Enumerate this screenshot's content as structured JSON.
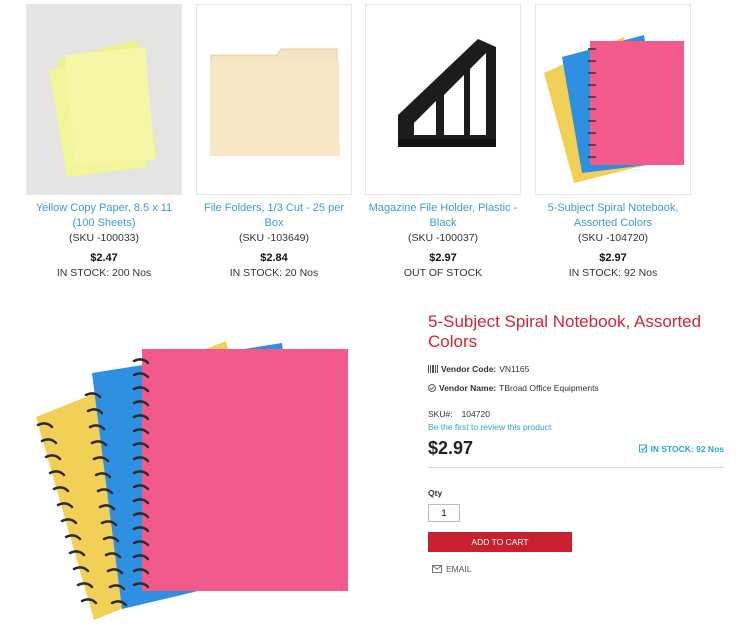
{
  "related_products": [
    {
      "name": "Yellow Copy Paper, 8.5 x 11 (100 Sheets)",
      "sku": "(SKU -100033)",
      "price": "$2.47",
      "stock": "IN STOCK: 200 Nos"
    },
    {
      "name": "File Folders, 1/3 Cut - 25 per Box",
      "sku": "(SKU -103649)",
      "price": "$2.84",
      "stock": "IN STOCK: 20 Nos"
    },
    {
      "name": "Magazine File Holder, Plastic - Black",
      "sku": "(SKU -100037)",
      "price": "$2.97",
      "stock": "OUT OF STOCK"
    },
    {
      "name": "5-Subject Spiral Notebook, Assorted Colors",
      "sku": "(SKU -104720)",
      "price": "$2.97",
      "stock": "IN STOCK: 92 Nos"
    }
  ],
  "product": {
    "title": "5-Subject Spiral Notebook, Assorted Colors",
    "vendor_code_label": "Vendor Code:",
    "vendor_code": "VN1165",
    "vendor_name_label": "Vendor Name:",
    "vendor_name": "TBroad Office Equipments",
    "sku_label": "SKU#:",
    "sku": "104720",
    "review_link": "Be the first to review this product",
    "price": "$2.97",
    "stock": "IN STOCK: 92 Nos",
    "qty_label": "Qty",
    "qty_value": "1",
    "add_to_cart": "ADD TO CART",
    "email_label": "EMAIL"
  },
  "colors": {
    "link": "#3a9bd6",
    "title_red": "#d0243a",
    "cart_button": "#c8202f",
    "stock_teal": "#2aa5c4"
  }
}
